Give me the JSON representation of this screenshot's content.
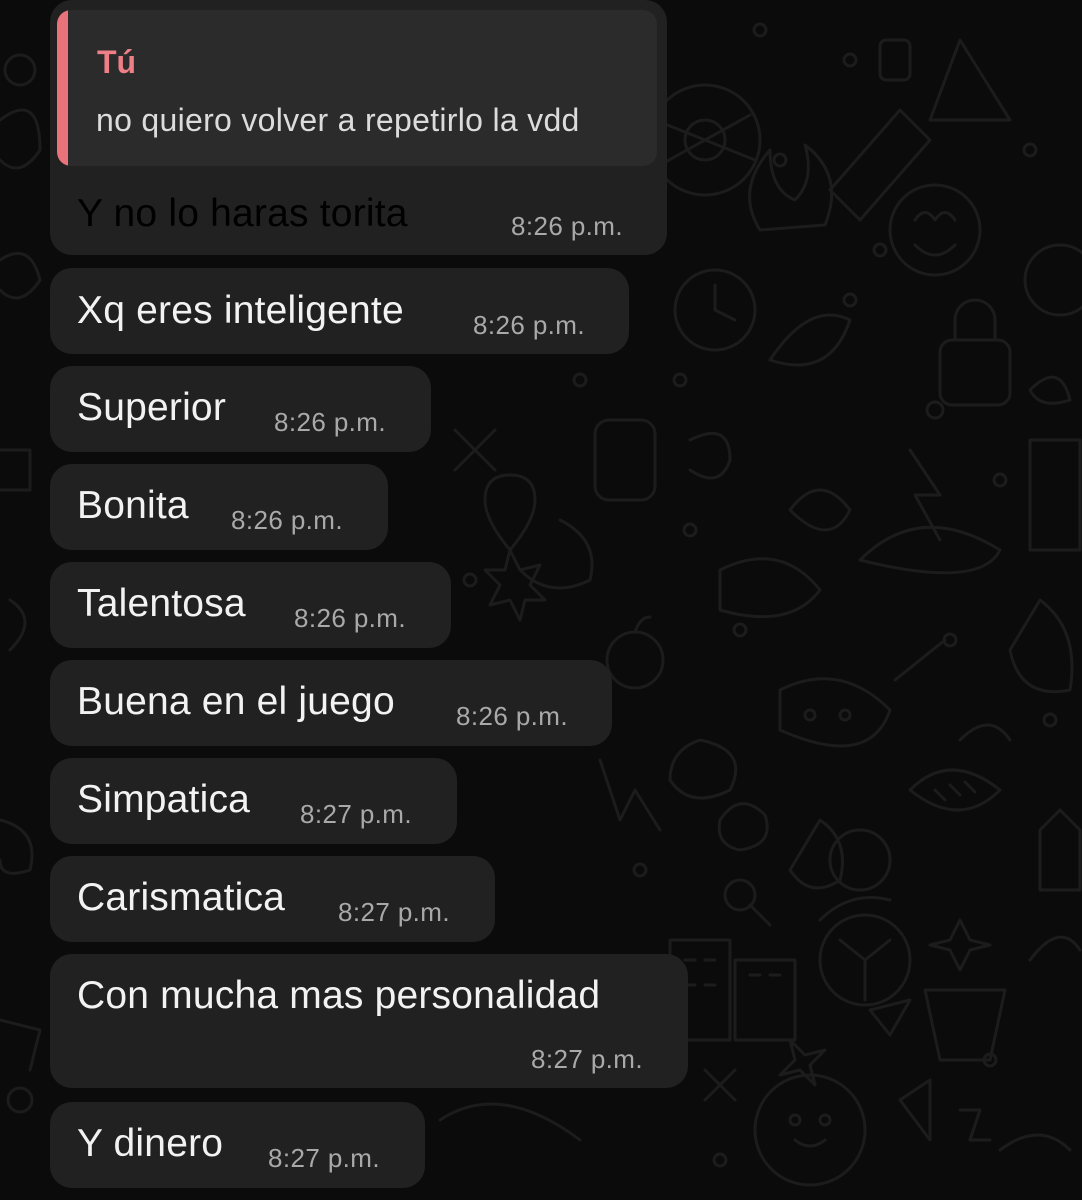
{
  "chat": {
    "reply_quote": {
      "author": "Tú",
      "text": "no quiero volver a repetirlo la vdd"
    },
    "messages": [
      {
        "text": "Y no lo haras torita",
        "time": "8:26 p.m."
      },
      {
        "text": "Xq eres inteligente",
        "time": "8:26 p.m."
      },
      {
        "text": "Superior",
        "time": "8:26 p.m."
      },
      {
        "text": "Bonita",
        "time": "8:26 p.m."
      },
      {
        "text": "Talentosa",
        "time": "8:26 p.m."
      },
      {
        "text": "Buena en el juego",
        "time": "8:26 p.m."
      },
      {
        "text": "Simpatica",
        "time": "8:27 p.m."
      },
      {
        "text": "Carismatica",
        "time": "8:27 p.m."
      },
      {
        "text": "Con mucha mas personalidad",
        "time": "8:27 p.m."
      },
      {
        "text": "Y dinero",
        "time": "8:27 p.m."
      }
    ]
  },
  "colors": {
    "background": "#0b0b0b",
    "bubble": "#212121",
    "quote_accent": "#e8737a",
    "timestamp": "#a9a9a9"
  },
  "icons": [
    "doodle-wallpaper-pattern"
  ]
}
